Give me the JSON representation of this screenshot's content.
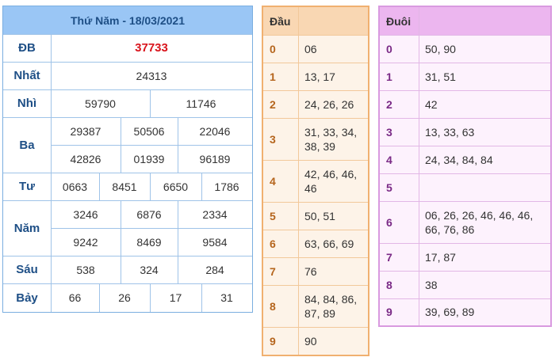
{
  "results": {
    "title": "Thứ Năm - 18/03/2021",
    "rows": [
      {
        "label": "ĐB",
        "values": [
          "37733"
        ]
      },
      {
        "label": "Nhất",
        "values": [
          "24313"
        ]
      },
      {
        "label": "Nhì",
        "values": [
          "59790",
          "11746"
        ]
      },
      {
        "label": "Ba",
        "values": [
          "29387",
          "50506",
          "22046",
          "42826",
          "01939",
          "96189"
        ]
      },
      {
        "label": "Tư",
        "values": [
          "0663",
          "8451",
          "6650",
          "1786"
        ]
      },
      {
        "label": "Năm",
        "values": [
          "3246",
          "6876",
          "2334",
          "9242",
          "8469",
          "9584"
        ]
      },
      {
        "label": "Sáu",
        "values": [
          "538",
          "324",
          "284"
        ]
      },
      {
        "label": "Bảy",
        "values": [
          "66",
          "26",
          "17",
          "31"
        ]
      }
    ]
  },
  "dau": {
    "header_key": "Đầu",
    "header_val": "",
    "rows": [
      {
        "key": "0",
        "val": "06"
      },
      {
        "key": "1",
        "val": "13, 17"
      },
      {
        "key": "2",
        "val": "24, 26, 26"
      },
      {
        "key": "3",
        "val": "31, 33, 34, 38, 39"
      },
      {
        "key": "4",
        "val": "42, 46, 46, 46"
      },
      {
        "key": "5",
        "val": "50, 51"
      },
      {
        "key": "6",
        "val": "63, 66, 69"
      },
      {
        "key": "7",
        "val": "76"
      },
      {
        "key": "8",
        "val": "84, 84, 86, 87, 89"
      },
      {
        "key": "9",
        "val": "90"
      }
    ]
  },
  "duoi": {
    "header_key": "Đuôi",
    "header_val": "",
    "rows": [
      {
        "key": "0",
        "val": "50, 90"
      },
      {
        "key": "1",
        "val": "31, 51"
      },
      {
        "key": "2",
        "val": "42"
      },
      {
        "key": "3",
        "val": "13, 33, 63"
      },
      {
        "key": "4",
        "val": "24, 34, 84, 84"
      },
      {
        "key": "5",
        "val": ""
      },
      {
        "key": "6",
        "val": "06, 26, 26, 46, 46, 46, 66, 76, 86"
      },
      {
        "key": "7",
        "val": "17, 87"
      },
      {
        "key": "8",
        "val": "38"
      },
      {
        "key": "9",
        "val": "39, 69, 89"
      }
    ]
  },
  "colors": {
    "results_header": "#9ac6f5",
    "special_prize": "#d9141c",
    "dau_border": "#f0b070",
    "duoi_border": "#d99ae0"
  }
}
